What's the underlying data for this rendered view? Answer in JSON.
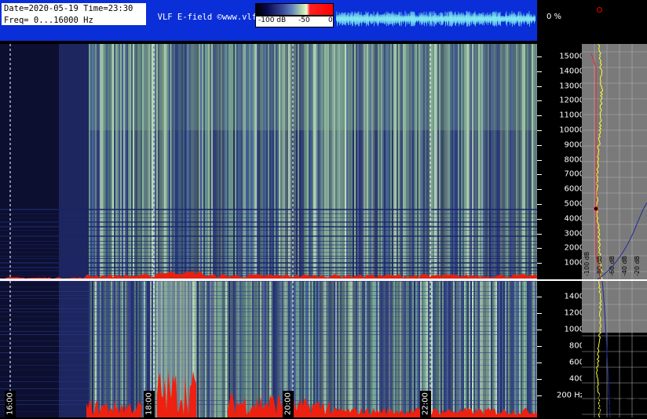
{
  "header": {
    "date_line": "Date=2020-05-19 Time=23:30",
    "freq_line": "Freq= 0...16000 Hz",
    "site_text": "  VLF E-field ©www.vlf.it",
    "percent": "0 %"
  },
  "colorbar": {
    "labels": [
      "-100 dB",
      "-50",
      "0"
    ]
  },
  "axis_top": {
    "ticks": [
      "15000",
      "14000",
      "13000",
      "12000",
      "11000",
      "10000",
      "9000",
      "8000",
      "7000",
      "6000",
      "5000",
      "4000",
      "3000",
      "2000",
      "1000"
    ]
  },
  "axis_bottom": {
    "ticks": [
      "1400",
      "1200",
      "1000",
      "800",
      "600",
      "400",
      "200 Hz"
    ]
  },
  "profile_labels": [
    "-100 dB",
    "-80 dB",
    "-60 dB",
    "-40 dB",
    "-20 dB"
  ],
  "time_labels": [
    "16:00",
    "18:00",
    "20:00",
    "22:00"
  ],
  "colors": {
    "header_bg": "#0a2fd8",
    "profile_bg": "#7a7a7a",
    "trace_yellow": "#ffff33",
    "trace_red": "#ff2020",
    "trace_blue": "#1a2a9a"
  }
}
